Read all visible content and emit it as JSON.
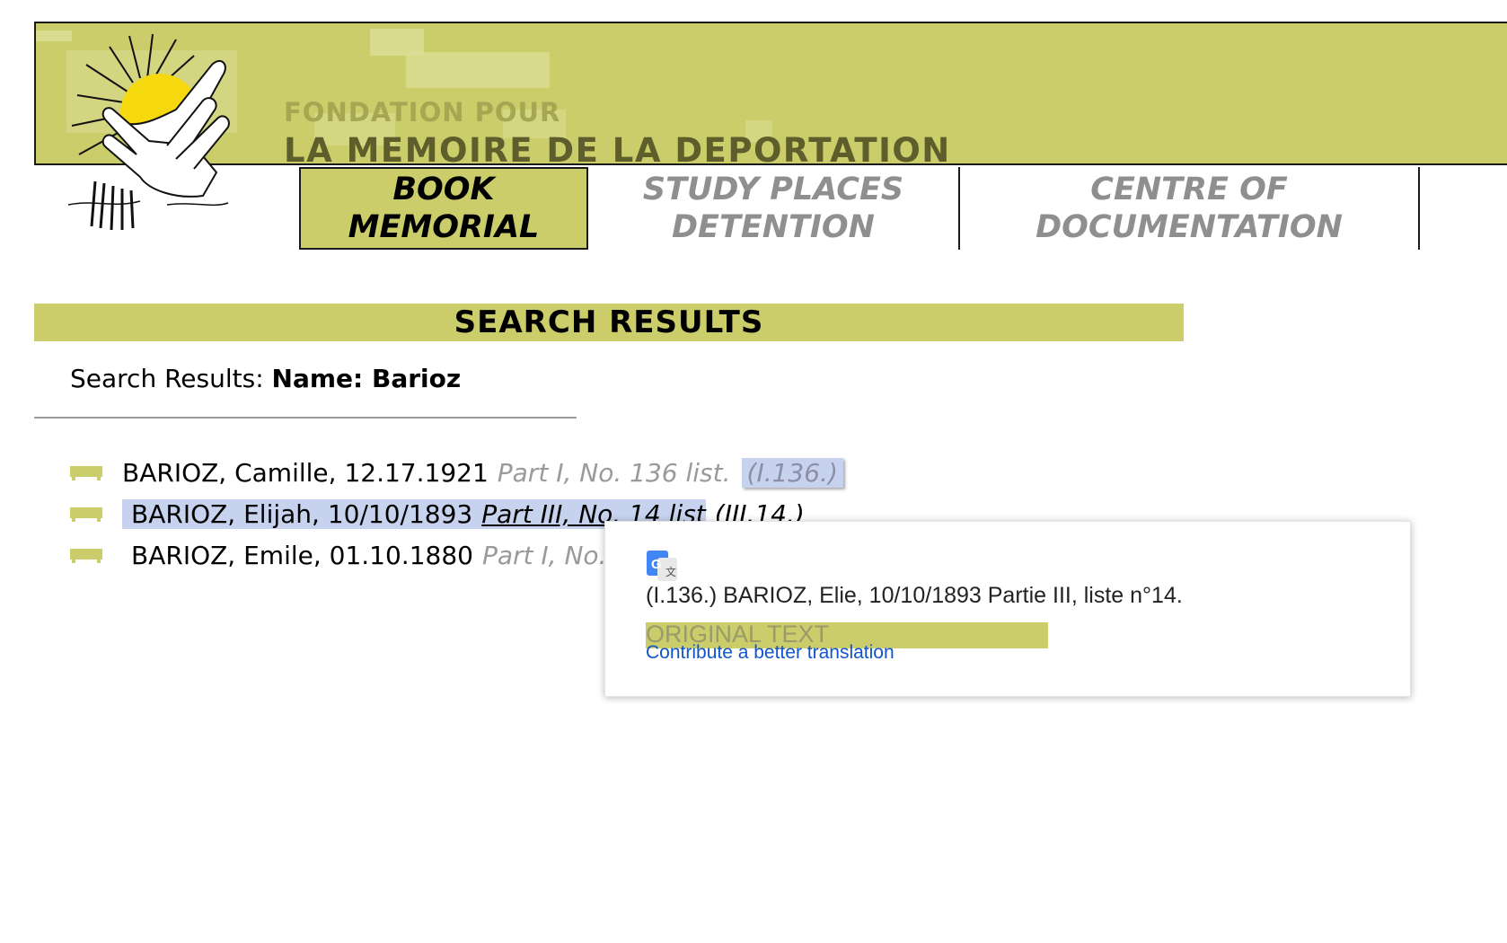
{
  "header": {
    "brand_top": "FONDATION POUR",
    "brand_main": "LA MEMOIRE DE LA DEPORTATION",
    "logo_icon": "sun-hands-logo-icon"
  },
  "nav": {
    "tabs": [
      {
        "line1": "BOOK",
        "line2": "MEMORIAL",
        "active": true
      },
      {
        "line1": "STUDY PLACES",
        "line2": "DETENTION",
        "active": false
      },
      {
        "line1": "CENTRE OF",
        "line2": "DOCUMENTATION",
        "active": false
      }
    ]
  },
  "results": {
    "bar_title": "SEARCH RESULTS",
    "query_prefix": "Search Results:",
    "query_value": "Name: Barioz",
    "rows": [
      {
        "name": "BARIOZ, Camille, 12.17.1921",
        "ref": "Part I, No. 136 list.",
        "code": "(I.136.)"
      },
      {
        "name": "BARIOZ, Elijah, 10/10/1893",
        "ref": "Part III, No. 14 list",
        "code": "(III.14.)"
      },
      {
        "name": "BARIOZ, Emile, 01.10.1880",
        "ref": "Part I, No.",
        "code": ""
      }
    ]
  },
  "translate_popup": {
    "icon": "google-translate-icon",
    "translated_text": "(I.136.) BARIOZ, Elie, 10/10/1893 Partie III, liste n°14.",
    "original_label": "ORIGINAL TEXT",
    "contribute_link": "Contribute a better translation"
  },
  "colors": {
    "accent_olive": "#cbcc6a",
    "highlight_blue": "#c7d3ee",
    "link_blue": "#1155cc"
  }
}
